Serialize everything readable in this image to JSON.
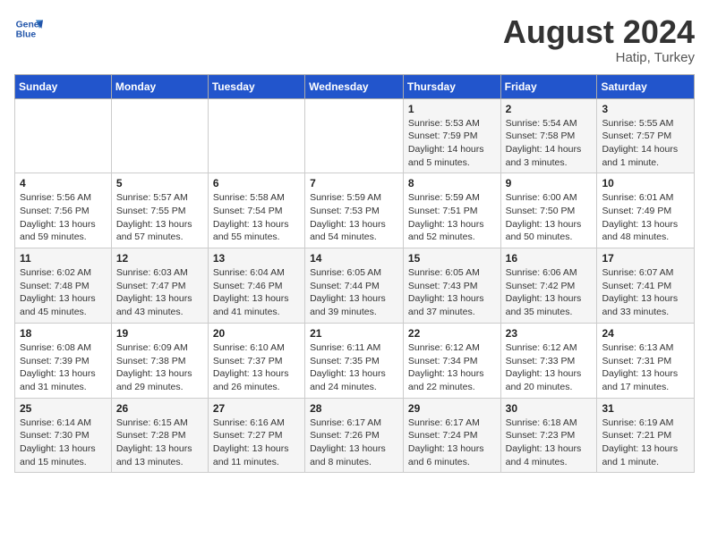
{
  "header": {
    "logo_line1": "General",
    "logo_line2": "Blue",
    "month_year": "August 2024",
    "location": "Hatip, Turkey"
  },
  "days_of_week": [
    "Sunday",
    "Monday",
    "Tuesday",
    "Wednesday",
    "Thursday",
    "Friday",
    "Saturday"
  ],
  "weeks": [
    [
      {
        "day": "",
        "info": ""
      },
      {
        "day": "",
        "info": ""
      },
      {
        "day": "",
        "info": ""
      },
      {
        "day": "",
        "info": ""
      },
      {
        "day": "1",
        "info": "Sunrise: 5:53 AM\nSunset: 7:59 PM\nDaylight: 14 hours\nand 5 minutes."
      },
      {
        "day": "2",
        "info": "Sunrise: 5:54 AM\nSunset: 7:58 PM\nDaylight: 14 hours\nand 3 minutes."
      },
      {
        "day": "3",
        "info": "Sunrise: 5:55 AM\nSunset: 7:57 PM\nDaylight: 14 hours\nand 1 minute."
      }
    ],
    [
      {
        "day": "4",
        "info": "Sunrise: 5:56 AM\nSunset: 7:56 PM\nDaylight: 13 hours\nand 59 minutes."
      },
      {
        "day": "5",
        "info": "Sunrise: 5:57 AM\nSunset: 7:55 PM\nDaylight: 13 hours\nand 57 minutes."
      },
      {
        "day": "6",
        "info": "Sunrise: 5:58 AM\nSunset: 7:54 PM\nDaylight: 13 hours\nand 55 minutes."
      },
      {
        "day": "7",
        "info": "Sunrise: 5:59 AM\nSunset: 7:53 PM\nDaylight: 13 hours\nand 54 minutes."
      },
      {
        "day": "8",
        "info": "Sunrise: 5:59 AM\nSunset: 7:51 PM\nDaylight: 13 hours\nand 52 minutes."
      },
      {
        "day": "9",
        "info": "Sunrise: 6:00 AM\nSunset: 7:50 PM\nDaylight: 13 hours\nand 50 minutes."
      },
      {
        "day": "10",
        "info": "Sunrise: 6:01 AM\nSunset: 7:49 PM\nDaylight: 13 hours\nand 48 minutes."
      }
    ],
    [
      {
        "day": "11",
        "info": "Sunrise: 6:02 AM\nSunset: 7:48 PM\nDaylight: 13 hours\nand 45 minutes."
      },
      {
        "day": "12",
        "info": "Sunrise: 6:03 AM\nSunset: 7:47 PM\nDaylight: 13 hours\nand 43 minutes."
      },
      {
        "day": "13",
        "info": "Sunrise: 6:04 AM\nSunset: 7:46 PM\nDaylight: 13 hours\nand 41 minutes."
      },
      {
        "day": "14",
        "info": "Sunrise: 6:05 AM\nSunset: 7:44 PM\nDaylight: 13 hours\nand 39 minutes."
      },
      {
        "day": "15",
        "info": "Sunrise: 6:05 AM\nSunset: 7:43 PM\nDaylight: 13 hours\nand 37 minutes."
      },
      {
        "day": "16",
        "info": "Sunrise: 6:06 AM\nSunset: 7:42 PM\nDaylight: 13 hours\nand 35 minutes."
      },
      {
        "day": "17",
        "info": "Sunrise: 6:07 AM\nSunset: 7:41 PM\nDaylight: 13 hours\nand 33 minutes."
      }
    ],
    [
      {
        "day": "18",
        "info": "Sunrise: 6:08 AM\nSunset: 7:39 PM\nDaylight: 13 hours\nand 31 minutes."
      },
      {
        "day": "19",
        "info": "Sunrise: 6:09 AM\nSunset: 7:38 PM\nDaylight: 13 hours\nand 29 minutes."
      },
      {
        "day": "20",
        "info": "Sunrise: 6:10 AM\nSunset: 7:37 PM\nDaylight: 13 hours\nand 26 minutes."
      },
      {
        "day": "21",
        "info": "Sunrise: 6:11 AM\nSunset: 7:35 PM\nDaylight: 13 hours\nand 24 minutes."
      },
      {
        "day": "22",
        "info": "Sunrise: 6:12 AM\nSunset: 7:34 PM\nDaylight: 13 hours\nand 22 minutes."
      },
      {
        "day": "23",
        "info": "Sunrise: 6:12 AM\nSunset: 7:33 PM\nDaylight: 13 hours\nand 20 minutes."
      },
      {
        "day": "24",
        "info": "Sunrise: 6:13 AM\nSunset: 7:31 PM\nDaylight: 13 hours\nand 17 minutes."
      }
    ],
    [
      {
        "day": "25",
        "info": "Sunrise: 6:14 AM\nSunset: 7:30 PM\nDaylight: 13 hours\nand 15 minutes."
      },
      {
        "day": "26",
        "info": "Sunrise: 6:15 AM\nSunset: 7:28 PM\nDaylight: 13 hours\nand 13 minutes."
      },
      {
        "day": "27",
        "info": "Sunrise: 6:16 AM\nSunset: 7:27 PM\nDaylight: 13 hours\nand 11 minutes."
      },
      {
        "day": "28",
        "info": "Sunrise: 6:17 AM\nSunset: 7:26 PM\nDaylight: 13 hours\nand 8 minutes."
      },
      {
        "day": "29",
        "info": "Sunrise: 6:17 AM\nSunset: 7:24 PM\nDaylight: 13 hours\nand 6 minutes."
      },
      {
        "day": "30",
        "info": "Sunrise: 6:18 AM\nSunset: 7:23 PM\nDaylight: 13 hours\nand 4 minutes."
      },
      {
        "day": "31",
        "info": "Sunrise: 6:19 AM\nSunset: 7:21 PM\nDaylight: 13 hours\nand 1 minute."
      }
    ]
  ]
}
